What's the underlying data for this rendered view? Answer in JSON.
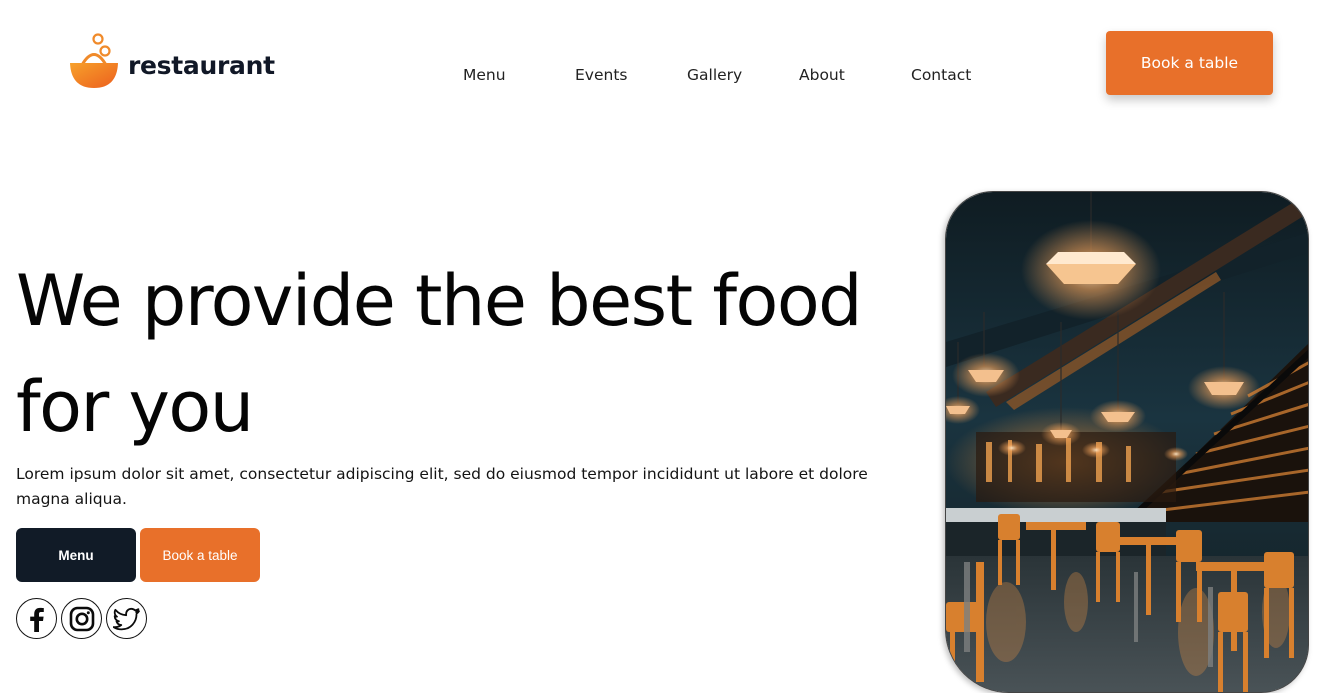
{
  "brand": {
    "name": "restaurant",
    "accent_color": "#e8702a",
    "dark_color": "#111b27"
  },
  "nav": {
    "items": [
      {
        "label": "Menu"
      },
      {
        "label": "Events"
      },
      {
        "label": "Gallery"
      },
      {
        "label": "About"
      },
      {
        "label": "Contact"
      }
    ]
  },
  "header": {
    "cta_label": "Book a table"
  },
  "hero": {
    "title_line1": "We provide the best food",
    "title_line2": "for you",
    "description": "Lorem ipsum dolor sit amet, consectetur adipiscing elit, sed do eiusmod tempor incididunt ut labore et dolore magna aliqua.",
    "menu_button_label": "Menu",
    "book_button_label": "Book a table"
  },
  "socials": [
    {
      "icon": "facebook-icon"
    },
    {
      "icon": "instagram-icon"
    },
    {
      "icon": "twitter-icon"
    }
  ],
  "hero_image": {
    "subject": "restaurant interior"
  }
}
